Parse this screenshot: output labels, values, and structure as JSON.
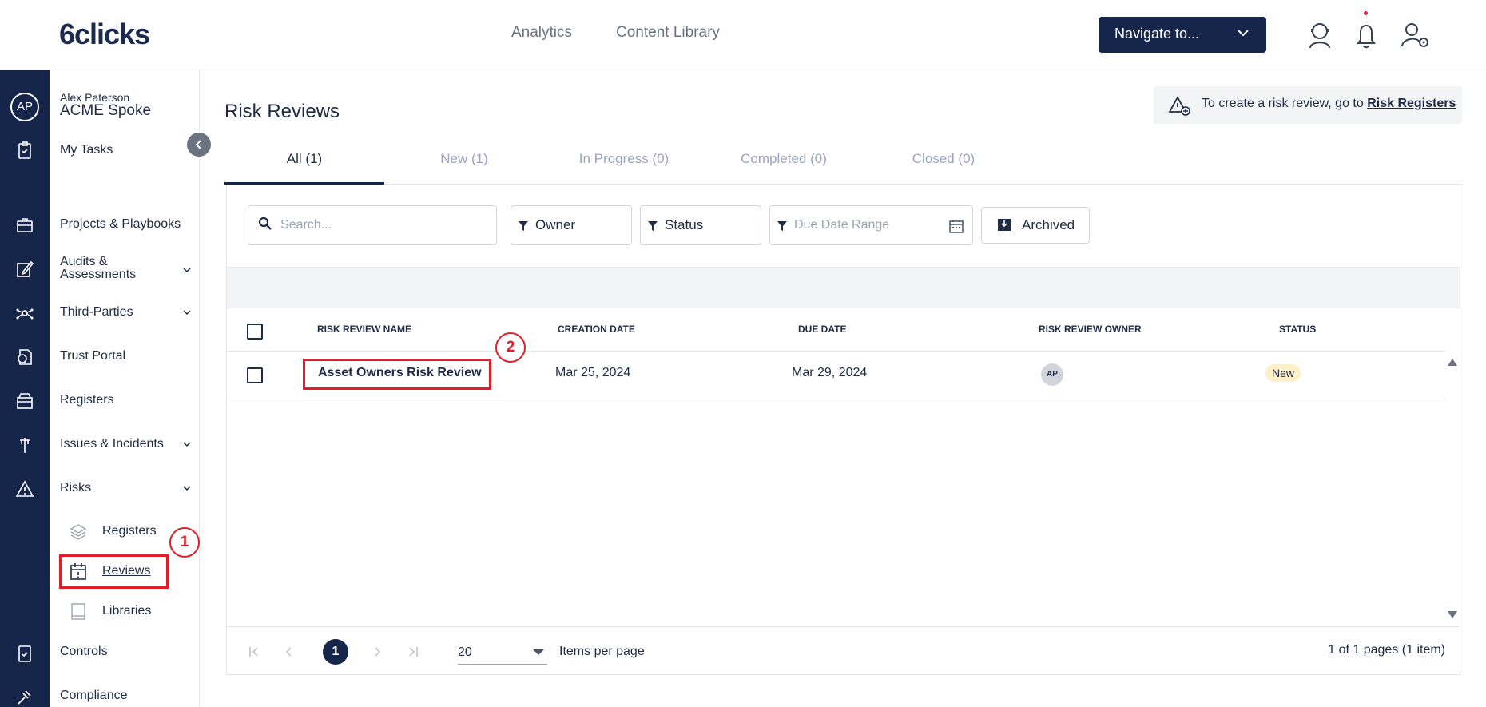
{
  "header": {
    "logo": "6clicks",
    "nav": [
      "Analytics",
      "Content Library"
    ],
    "navigate_label": "Navigate to..."
  },
  "rail": {
    "avatar_initials": "AP"
  },
  "sidebar": {
    "user_name": "Alex Paterson",
    "org_name": "ACME Spoke",
    "items": [
      {
        "label": "My Tasks"
      },
      {
        "label": "Projects & Playbooks"
      },
      {
        "label": "Audits &\nAssessments"
      },
      {
        "label": "Third-Parties"
      },
      {
        "label": "Trust Portal"
      },
      {
        "label": "Registers"
      },
      {
        "label": "Issues & Incidents"
      },
      {
        "label": "Risks"
      },
      {
        "label": "Controls"
      },
      {
        "label": "Compliance"
      }
    ],
    "risk_sub": [
      {
        "label": "Registers"
      },
      {
        "label": "Reviews"
      },
      {
        "label": "Libraries"
      }
    ]
  },
  "main": {
    "title": "Risk Reviews",
    "banner_text": "To create a risk review, go to ",
    "banner_link": "Risk Registers",
    "tabs": [
      {
        "label": "All (1)"
      },
      {
        "label": "New (1)"
      },
      {
        "label": "In Progress (0)"
      },
      {
        "label": "Completed (0)"
      },
      {
        "label": "Closed (0)"
      }
    ],
    "filters": {
      "search_placeholder": "Search...",
      "owner": "Owner",
      "status": "Status",
      "due_date_placeholder": "Due Date Range",
      "archived": "Archived"
    },
    "table": {
      "headers": [
        "RISK REVIEW NAME",
        "CREATION DATE",
        "DUE DATE",
        "RISK REVIEW OWNER",
        "STATUS"
      ],
      "rows": [
        {
          "name": "Asset Owners Risk Review",
          "created": "Mar 25, 2024",
          "due": "Mar 29, 2024",
          "owner": "AP",
          "status": "New"
        }
      ]
    },
    "pager": {
      "current": "1",
      "page_size": "20",
      "items_label": "Items per page",
      "info": "1 of 1 pages (1 item)"
    }
  },
  "annotations": [
    "1",
    "2"
  ],
  "colors": {
    "navy": "#16254a",
    "highlight": "#e11d2a",
    "badge_new": "#fdf0c8"
  }
}
